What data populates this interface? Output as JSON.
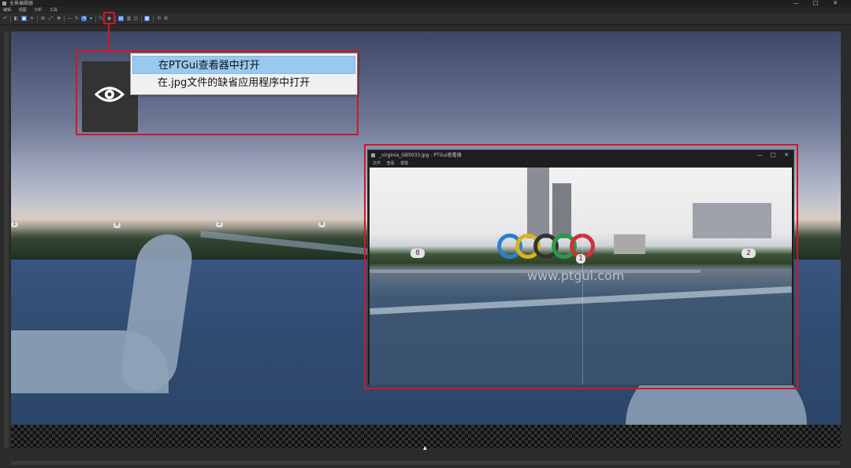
{
  "window": {
    "title": "全景编辑器",
    "controls": [
      "—",
      "□",
      "✕"
    ]
  },
  "menubar": {
    "items": [
      "编辑",
      "视图",
      "分析",
      "工具"
    ]
  },
  "context_menu": {
    "items": [
      {
        "label": "在PTGui查看器中打开"
      },
      {
        "label": "在.jpg文件的缺省应用程序中打开"
      }
    ]
  },
  "eye_tile": {
    "icon": "eye-icon"
  },
  "control_points": [
    "1",
    "8",
    "2",
    "8"
  ],
  "viewer_window": {
    "title": "_virginia_GB5033.jpg - PTGui查看器",
    "menu": [
      "文件",
      "查看",
      "帮助"
    ],
    "controls": [
      "—",
      "□",
      "✕"
    ],
    "watermark": "www.ptgui.com",
    "control_points": [
      "8",
      "1",
      "2"
    ]
  },
  "colors": {
    "highlight": "#d0162a",
    "menu_active": "#99c9ef"
  }
}
